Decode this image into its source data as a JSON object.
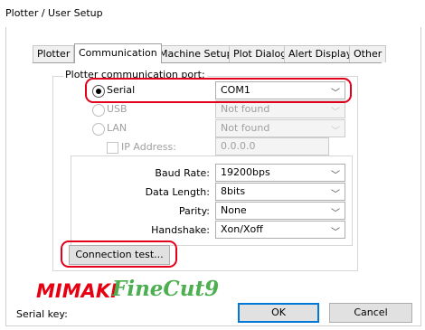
{
  "window": {
    "title": "Plotter / User Setup"
  },
  "tabs": [
    {
      "label": "Plotter",
      "active": false
    },
    {
      "label": "Communication",
      "active": true
    },
    {
      "label": "Machine Setup",
      "active": false
    },
    {
      "label": "Plot Dialog",
      "active": false
    },
    {
      "label": "Alert Display",
      "active": false
    },
    {
      "label": "Other",
      "active": false
    }
  ],
  "port_group": {
    "title": "Plotter communication port:"
  },
  "ports": {
    "serial": {
      "label": "Serial",
      "selected": true,
      "value": "COM1"
    },
    "usb": {
      "label": "USB",
      "selected": false,
      "value": "Not found",
      "enabled": false
    },
    "lan": {
      "label": "LAN",
      "selected": false,
      "value": "Not found",
      "enabled": false
    },
    "ip": {
      "label": "IP Address:",
      "value": "0.0.0.0",
      "checked": false,
      "enabled": false
    }
  },
  "serial_settings": {
    "baud_rate": {
      "label": "Baud Rate:",
      "value": "19200bps"
    },
    "data_length": {
      "label": "Data Length:",
      "value": "8bits"
    },
    "parity": {
      "label": "Parity:",
      "value": "None"
    },
    "handshake": {
      "label": "Handshake:",
      "value": "Xon/Xoff"
    }
  },
  "buttons": {
    "connection_test": "Connection test...",
    "ok": "OK",
    "cancel": "Cancel"
  },
  "footer": {
    "serial_key_label": "Serial key:",
    "logo_brand": "MIMAKI",
    "logo_product": "FineCut9"
  },
  "colors": {
    "highlight": "#e2001a",
    "brand_red": "#e60012",
    "brand_green": "#4caf50",
    "focus_blue": "#0078d7"
  },
  "icons": {
    "dropdown": "chevron-down-icon"
  }
}
